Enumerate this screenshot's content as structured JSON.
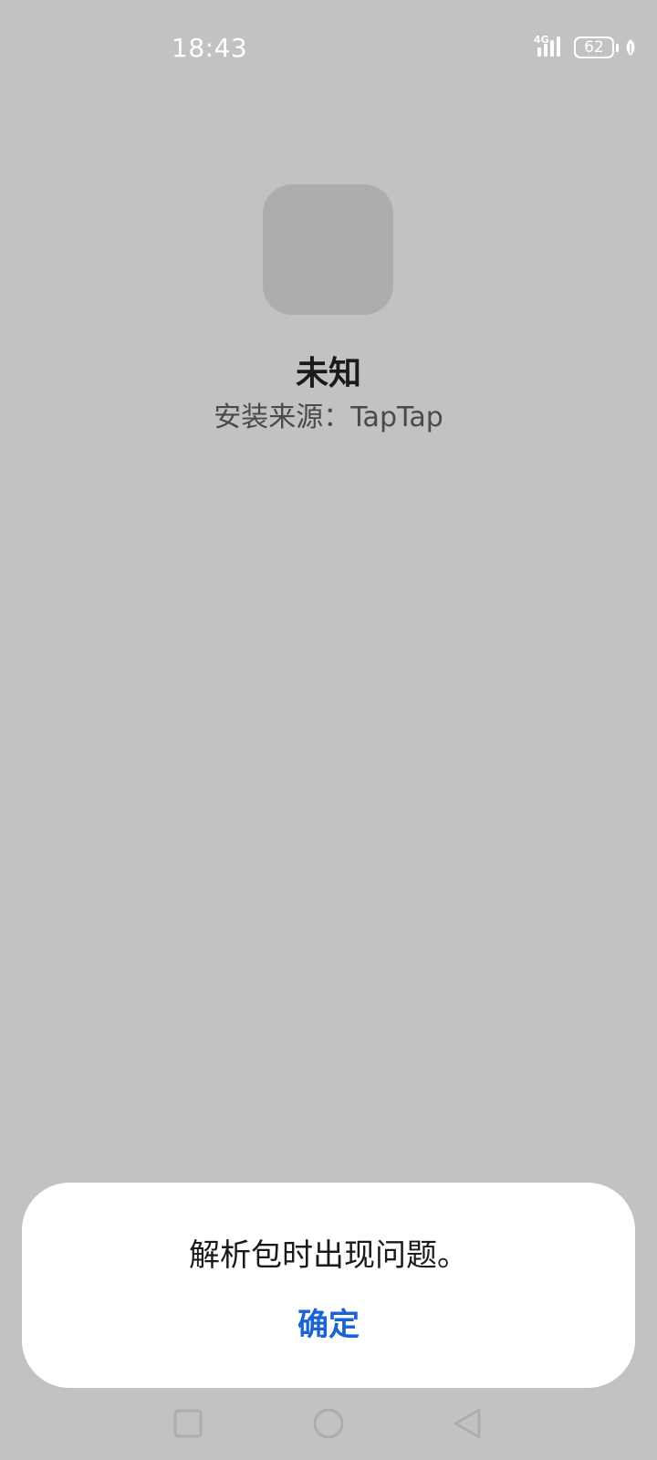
{
  "status_bar": {
    "time": "18:43",
    "network_type": "4G",
    "battery_level": "62",
    "icons": [
      "signal-icon",
      "battery-icon",
      "battery-saver-leaf-icon"
    ]
  },
  "app": {
    "name": "未知",
    "install_source": "安装来源：TapTap",
    "icon": "app-placeholder-icon"
  },
  "dialog": {
    "message": "解析包时出现问题。",
    "confirm_label": "确定"
  },
  "colors": {
    "background": "#c1c2c4",
    "icon_placeholder": "#acadaf",
    "dialog_bg": "#ffffff",
    "accent": "#1a63d6"
  },
  "nav_bar": {
    "icons": [
      "recents-square-icon",
      "home-circle-icon",
      "back-triangle-icon"
    ]
  }
}
